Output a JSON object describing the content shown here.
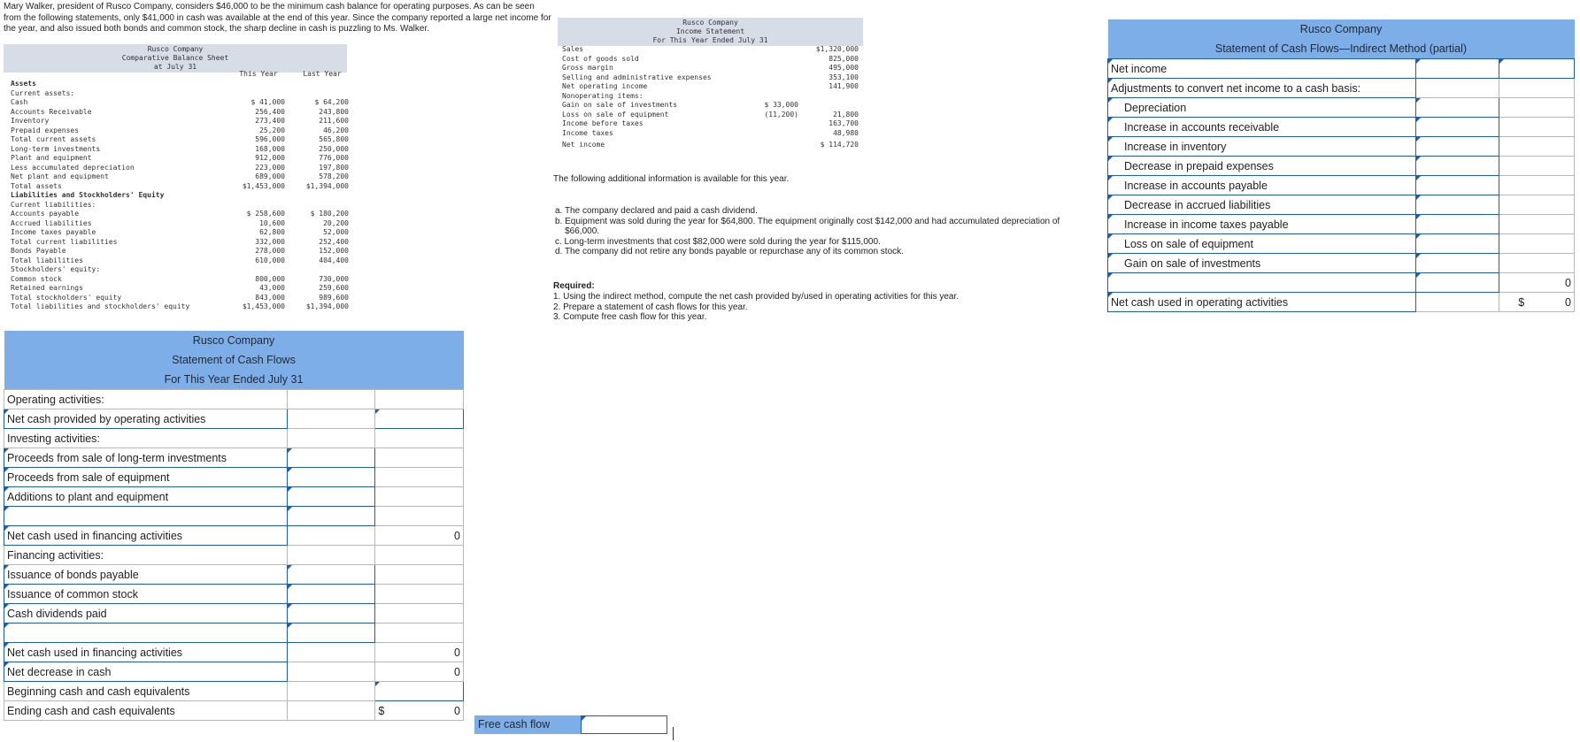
{
  "intro": "Mary Walker, president of Rusco Company, considers $46,000 to be the minimum cash balance for operating purposes. As can be seen from the following statements, only $41,000 in cash was available at the end of this year. Since the company reported a large net income for the year, and also issued both bonds and common stock, the sharp decline in cash is puzzling to Ms. Walker.",
  "balance_sheet": {
    "title1": "Rusco Company",
    "title2": "Comparative Balance Sheet",
    "title3": "at July 31",
    "col_this": "This Year",
    "col_last": "Last Year",
    "rows": [
      {
        "label": "Assets",
        "a": "",
        "b": "",
        "bold": true
      },
      {
        "label": "Current assets:",
        "a": "",
        "b": ""
      },
      {
        "label": "  Cash",
        "a": "$    41,000",
        "b": "$    64,200"
      },
      {
        "label": "  Accounts Receivable",
        "a": "256,400",
        "b": "243,800"
      },
      {
        "label": "  Inventory",
        "a": "273,400",
        "b": "211,600"
      },
      {
        "label": "  Prepaid expenses",
        "a": "25,200",
        "b": "46,200"
      },
      {
        "label": "Total current assets",
        "a": "596,000",
        "b": "565,800"
      },
      {
        "label": "Long-term investments",
        "a": "168,000",
        "b": "250,000"
      },
      {
        "label": "Plant and equipment",
        "a": "912,000",
        "b": "776,000"
      },
      {
        "label": "  Less accumulated depreciation",
        "a": "223,000",
        "b": "197,800"
      },
      {
        "label": "Net plant and equipment",
        "a": "689,000",
        "b": "578,200"
      },
      {
        "label": "Total assets",
        "a": "$1,453,000",
        "b": "$1,394,000"
      },
      {
        "label": "Liabilities and Stockholders' Equity",
        "a": "",
        "b": "",
        "bold": true
      },
      {
        "label": "Current liabilities:",
        "a": "",
        "b": ""
      },
      {
        "label": "  Accounts payable",
        "a": "$   258,600",
        "b": "$   180,200"
      },
      {
        "label": "  Accrued liabilities",
        "a": "10,600",
        "b": "20,200"
      },
      {
        "label": "  Income taxes payable",
        "a": "62,800",
        "b": "52,000"
      },
      {
        "label": "Total current liabilities",
        "a": "332,000",
        "b": "252,400"
      },
      {
        "label": "Bonds Payable",
        "a": "278,000",
        "b": "152,000"
      },
      {
        "label": "Total liabilities",
        "a": "610,000",
        "b": "404,400"
      },
      {
        "label": "Stockholders' equity:",
        "a": "",
        "b": ""
      },
      {
        "label": "  Common stock",
        "a": "800,000",
        "b": "730,000"
      },
      {
        "label": "  Retained earnings",
        "a": "43,000",
        "b": "259,600"
      },
      {
        "label": "Total stockholders' equity",
        "a": "843,000",
        "b": "989,600"
      },
      {
        "label": "Total liabilities and stockholders' equity",
        "a": "$1,453,000",
        "b": "$1,394,000"
      }
    ]
  },
  "income_statement": {
    "title1": "Rusco Company",
    "title2": "Income Statement",
    "title3": "For This Year Ended July 31",
    "rows": [
      {
        "label": "Sales",
        "a": "",
        "b": "$1,320,000"
      },
      {
        "label": "Cost of goods sold",
        "a": "",
        "b": "825,000"
      },
      {
        "label": "Gross margin",
        "a": "",
        "b": "495,000"
      },
      {
        "label": "Selling and administrative expenses",
        "a": "",
        "b": "353,100"
      },
      {
        "label": "Net operating income",
        "a": "",
        "b": "141,900"
      },
      {
        "label": "Nonoperating items:",
        "a": "",
        "b": ""
      },
      {
        "label": "  Gain on sale of investments",
        "a": "$ 33,000",
        "b": ""
      },
      {
        "label": "  Loss on sale of equipment",
        "a": "(11,200)",
        "b": "21,800"
      },
      {
        "label": "Income before taxes",
        "a": "",
        "b": "163,700"
      },
      {
        "label": "Income taxes",
        "a": "",
        "b": "48,980"
      },
      {
        "label": "Net income",
        "a": "",
        "b": "$  114,720"
      }
    ]
  },
  "additional_heading": "The following additional information is available for this year.",
  "additional": [
    "a. The company declared and paid a cash dividend.",
    "b. Equipment was sold during the year for $64,800. The equipment originally cost $142,000 and had accumulated depreciation of",
    "    $66,000.",
    "c. Long-term investments that cost $82,000 were sold during the year for $115,000.",
    "d. The company did not retire any bonds payable or repurchase any of its common stock."
  ],
  "required_heading": "Required:",
  "required": [
    "1. Using the indirect method, compute the net cash provided by/used in operating activities for this year.",
    "2. Prepare a statement of cash flows for this year.",
    "3. Compute free cash flow for this year."
  ],
  "cash_flow": {
    "title1": "Rusco Company",
    "title2": "Statement of Cash Flows",
    "title3": "For This Year Ended July 31",
    "operating_label": "Operating activities:",
    "net_operating": "Net cash provided by operating activities",
    "investing_label": "Investing activities:",
    "proceeds_investments": "Proceeds from sale of long-term investments",
    "proceeds_equipment": "Proceeds from sale of equipment",
    "additions_plant": "Additions to plant and equipment",
    "net_investing": "Net cash used in financing activities",
    "net_investing_value": "0",
    "financing_label": "Financing activities:",
    "issuance_bonds": "Issuance of bonds payable",
    "issuance_stock": "Issuance of common stock",
    "dividends": "Cash dividends paid",
    "net_financing": "Net cash used in financing activities",
    "net_financing_value": "0",
    "net_decrease": "Net decrease in cash",
    "net_decrease_value": "0",
    "beginning": "Beginning cash and cash equivalents",
    "ending": "Ending cash and cash equivalents",
    "ending_symbol": "$",
    "ending_value": "0"
  },
  "free_cash_flow_label": "Free cash flow",
  "indirect": {
    "title1": "Rusco Company",
    "title2": "Statement of Cash Flows—Indirect Method (partial)",
    "net_income": "Net income",
    "adjustments": "Adjustments to convert net income to a cash basis:",
    "items": [
      "Depreciation",
      "Increase in accounts receivable",
      "Increase in inventory",
      "Decrease in prepaid expenses",
      "Increase in accounts payable",
      "Decrease in accrued liabilities",
      "Increase in income taxes payable",
      "Loss on sale of equipment",
      "Gain on sale of investments"
    ],
    "subtotal_value": "0",
    "net_operating": "Net cash used in operating activities",
    "net_symbol": "$",
    "net_value": "0"
  }
}
